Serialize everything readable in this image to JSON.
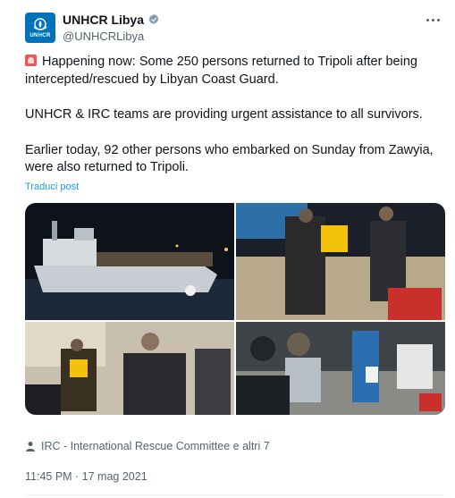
{
  "account": {
    "display_name": "UNHCR Libya",
    "handle": "@UNHCRLibya",
    "logo_text": "UNHCR",
    "verified": true
  },
  "tweet": {
    "paragraphs": [
      "Happening now: Some 250 persons returned to Tripoli after being intercepted/rescued by Libyan Coast Guard.",
      "UNHCR & IRC teams are providing urgent assistance to all survivors.",
      "Earlier today, 92 other persons who embarked on Sunday from Zawyia, were also returned to Tripoli."
    ],
    "lead_icon": "siren-emoji",
    "translate_label": "Traduci post"
  },
  "media": {
    "photos": [
      "boat-photo",
      "aid-worker-photo",
      "indoor-assistance-photo",
      "survivors-photo"
    ]
  },
  "tagged": {
    "text": "IRC - International Rescue Committee e altri 7"
  },
  "timestamp": "11:45 PM · 17 mag 2021",
  "colors": {
    "accent": "#1d9bf0",
    "unhcr_blue": "#0072bc",
    "muted": "#536471"
  }
}
